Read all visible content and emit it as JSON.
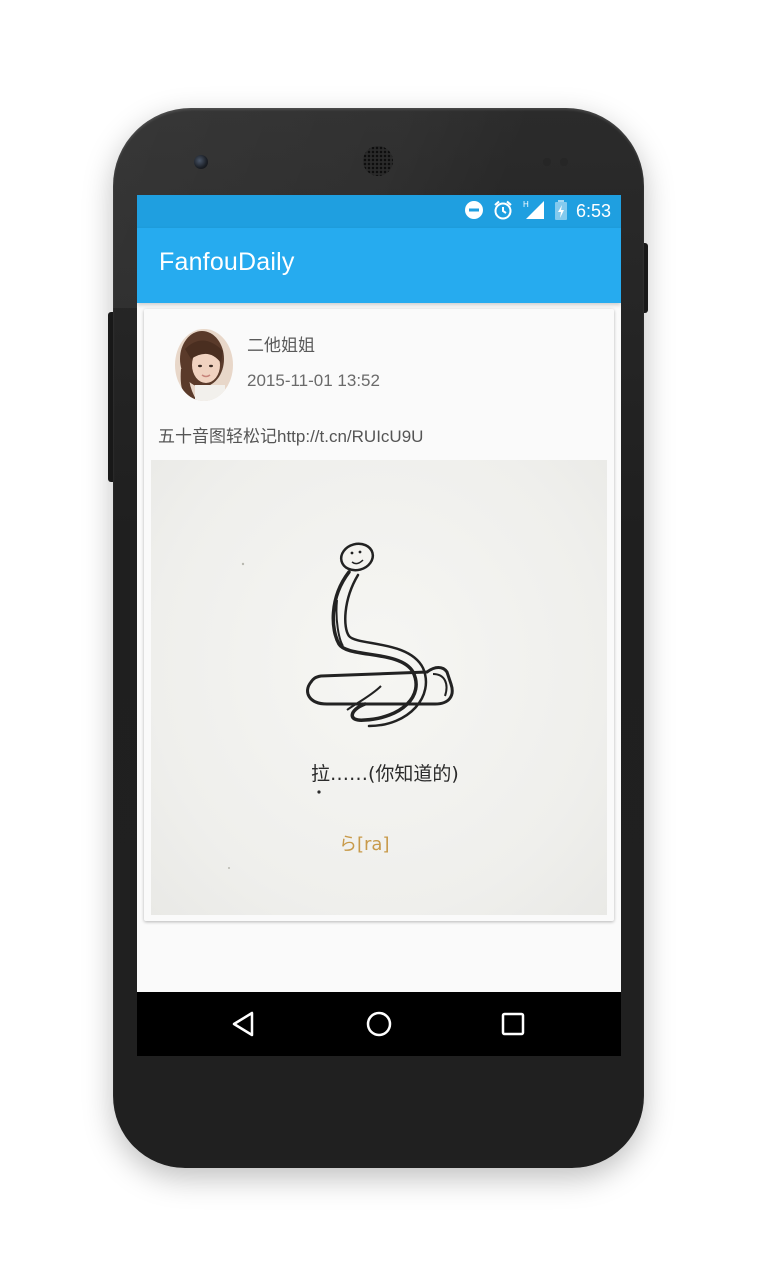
{
  "status_bar": {
    "time": "6:53",
    "icons": [
      "do-not-disturb-icon",
      "alarm-icon",
      "signal-icon",
      "battery-charging-icon"
    ],
    "network_label": "H"
  },
  "app_bar": {
    "title": "FanfouDaily"
  },
  "post": {
    "user_name": "二他姐姐",
    "timestamp": "2015-11-01 13:52",
    "text": "五十音图轻松记http://t.cn/RUIcU9U",
    "image": {
      "caption": "拉……(你知道的)",
      "kana_label": "ら[ra]"
    }
  },
  "nav_bar": {
    "icons": [
      "back-icon",
      "home-icon",
      "recent-apps-icon"
    ]
  },
  "colors": {
    "status_bar": "#1f9fe0",
    "app_bar": "#26abef",
    "nav_bar": "#000000",
    "kana_label": "#c89a4a"
  }
}
